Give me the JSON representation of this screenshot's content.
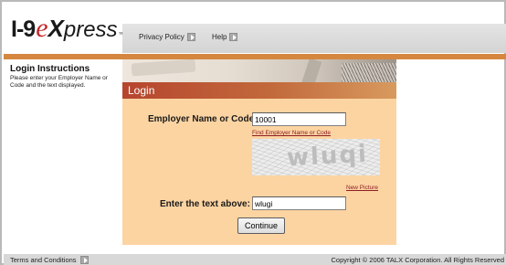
{
  "header": {
    "logo": {
      "part1": "I-9",
      "part2": "e",
      "part3": "X",
      "part4": "press",
      "tm": "™"
    },
    "nav": {
      "privacy": "Privacy Policy",
      "help": "Help"
    }
  },
  "left": {
    "title": "Login Instructions",
    "text": "Please enter your Employer Name or Code and the text displayed."
  },
  "banner": {
    "title": "Login"
  },
  "form": {
    "employer_label": "Employer Name or Code:",
    "employer_value": "10001",
    "find_link": "Find Employer Name or Code",
    "captcha_text": "wluqi",
    "new_picture": "New Picture",
    "enter_label": "Enter the text above:",
    "enter_value": "wlugi",
    "continue": "Continue"
  },
  "footer": {
    "terms": "Terms and Conditions",
    "copyright": "Copyright © 2006 TALX Corporation. All Rights Reserved"
  },
  "colors": {
    "brand_red": "#c4282b",
    "orange_bar": "#d5873f",
    "panel_bg": "#fcd4a2",
    "link": "#8b1f26"
  }
}
